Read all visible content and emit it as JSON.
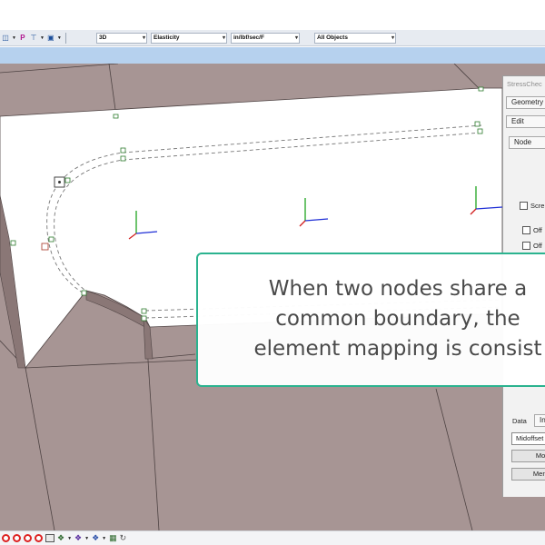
{
  "toolbar": {
    "icons": [
      "axes-icon",
      "property-icon",
      "node-icon",
      "camera-icon"
    ],
    "p_label": "P",
    "combo_view": "3D",
    "combo_analysis": "Elasticity",
    "combo_units": "in/lbf/sec/F",
    "combo_objects": "All Objects"
  },
  "panel": {
    "title": "StressChec",
    "tab_geometry": "Geometry",
    "tab_edit": "Edit",
    "tab_node": "Node",
    "check_screen": "Scre",
    "check_off1": "Off",
    "check_off2": "Off",
    "bottom_tab_data": "Data",
    "bottom_tab_in": "In",
    "field_midoffset": "Midoffset",
    "btn_move": "Mov",
    "btn_merge": "Merg"
  },
  "caption": {
    "line1": "When two nodes share a",
    "line2": "common boundary, the",
    "line3": "element mapping is consist"
  },
  "colors": {
    "viewport_bg": "#a79594",
    "caption_border": "#2bb38f",
    "toolbar_bg": "#e7ebf1",
    "band": "#b6d1ee"
  },
  "bottom_toolbar": {
    "icons": [
      "stop-icon",
      "stop-icon",
      "stop-icon",
      "stop-icon",
      "grid-icon",
      "node-tool-icon",
      "mesh-icon",
      "element-icon",
      "surface-icon",
      "refresh-icon"
    ]
  }
}
